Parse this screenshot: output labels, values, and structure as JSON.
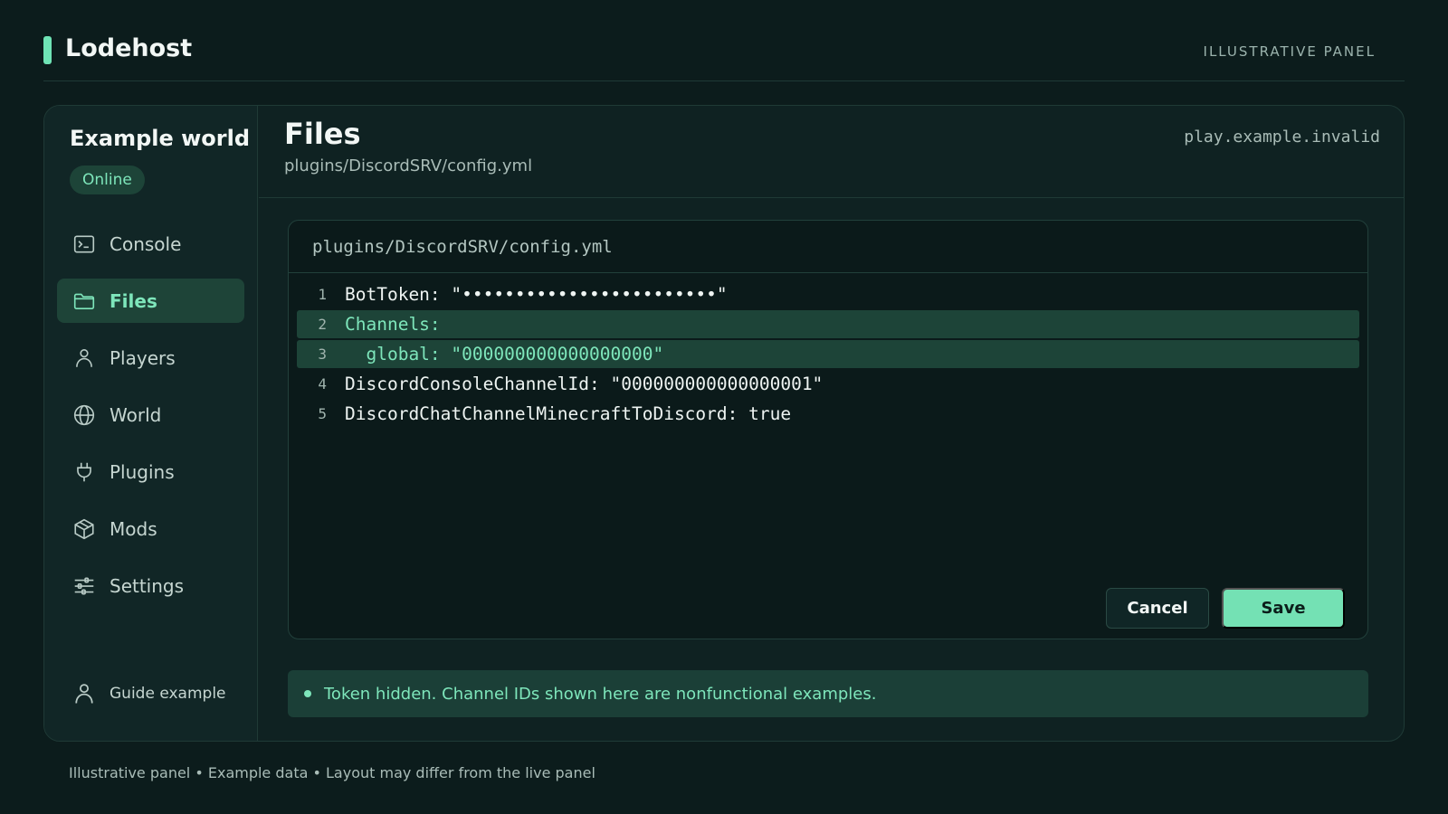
{
  "app": {
    "brand": "Lodehost",
    "panel_tag": "ILLUSTRATIVE PANEL"
  },
  "server": {
    "name": "Example world",
    "status": "Online",
    "host": "play.example.invalid"
  },
  "sidebar": {
    "items": [
      {
        "label": "Console",
        "icon": "terminal-icon"
      },
      {
        "label": "Files",
        "icon": "folder-icon",
        "active": true
      },
      {
        "label": "Players",
        "icon": "person-icon"
      },
      {
        "label": "World",
        "icon": "globe-icon"
      },
      {
        "label": "Plugins",
        "icon": "plug-icon"
      },
      {
        "label": "Mods",
        "icon": "box-icon"
      },
      {
        "label": "Settings",
        "icon": "sliders-icon"
      }
    ],
    "user": "Guide example"
  },
  "page": {
    "title": "Files",
    "path": "plugins/DiscordSRV/config.yml"
  },
  "editor": {
    "file": "plugins/DiscordSRV/config.yml",
    "lines": [
      {
        "n": "1",
        "text": "BotToken: \"••••••••••••••••••••••••\"",
        "highlight": false
      },
      {
        "n": "2",
        "text": "Channels:",
        "highlight": true
      },
      {
        "n": "3",
        "text": "  global: \"000000000000000000\"",
        "highlight": true
      },
      {
        "n": "4",
        "text": "DiscordConsoleChannelId: \"000000000000000001\"",
        "highlight": false
      },
      {
        "n": "5",
        "text": "DiscordChatChannelMinecraftToDiscord: true",
        "highlight": false
      }
    ],
    "cancel_label": "Cancel",
    "save_label": "Save"
  },
  "notice": "Token hidden. Channel IDs shown here are nonfunctional examples.",
  "footer": "Illustrative panel • Example data • Layout may differ from the live panel",
  "colors": {
    "accent": "#6fe3b5",
    "background": "#0c1c1c",
    "highlight": "#1d4438"
  }
}
